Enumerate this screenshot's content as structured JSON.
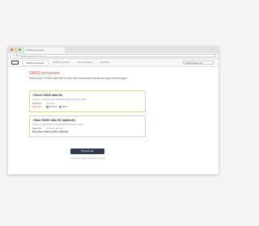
{
  "window": {
    "dot_colors": [
      "#fc605c",
      "#fdbc40",
      "#34c84a"
    ],
    "browser_tab": "GNSS processor",
    "url": "https://rtkplus.net/",
    "back_icon": "back-arrow-icon",
    "forward_icon": "forward-arrow-icon",
    "reload_icon": "reload-icon"
  },
  "appbar": {
    "tabs": [
      "GNSS processor",
      "GNSS to Excel",
      "My processes",
      "Settings"
    ],
    "active_tab": 0,
    "user": "info@rtkplus.net"
  },
  "page": {
    "title": "GNSS processor",
    "subtitle": "Select your GNSS data file to view and download results as maps and images"
  },
  "rover_card": {
    "title": "Rover GNSS data file",
    "description": "Choose or drag and drop GNSS data file of your base station",
    "select_label": "Select file",
    "file_value": "rover.obs",
    "input_type_label": "Input type",
    "options": [
      "Dynamic",
      "Static"
    ],
    "selected_option": 0
  },
  "base_card": {
    "title": "Base GNSS data file (optional)",
    "description": "Choose or drag and drop GNSS data file for base station",
    "select_label": "Select file",
    "file_value": "IGS base_obs.obs",
    "coords_label": "Enter base station position (optional)"
  },
  "process": {
    "button_label": "Process file",
    "note": "It may take a while to process your files"
  },
  "colors": {
    "accent": "#d9534f",
    "success": "#5cb85c",
    "button": "#2f3b48"
  }
}
